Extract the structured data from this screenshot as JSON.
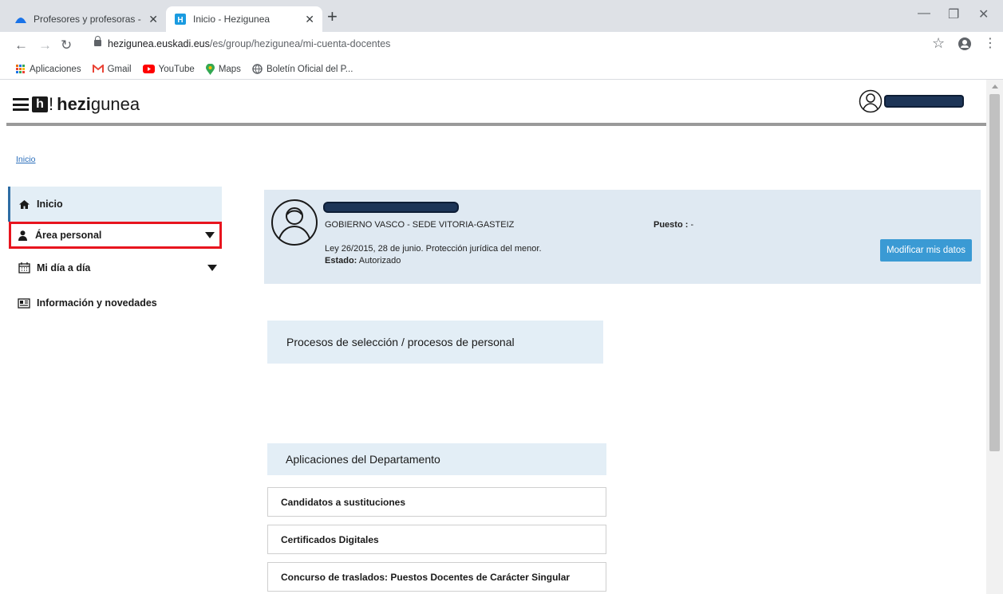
{
  "browser": {
    "tabs": [
      {
        "title": "Profesores y profesoras - Gestión",
        "active": false
      },
      {
        "title": "Inicio - Hezigunea",
        "active": true
      }
    ],
    "url_host": "hezigunea.euskadi.eus",
    "url_path": "/es/group/hezigunea/mi-cuenta-docentes",
    "bookmarks": [
      {
        "label": "Aplicaciones",
        "icon": "apps-grid-icon"
      },
      {
        "label": "Gmail",
        "icon": "gmail-icon"
      },
      {
        "label": "YouTube",
        "icon": "youtube-icon"
      },
      {
        "label": "Maps",
        "icon": "maps-pin-icon"
      },
      {
        "label": "Boletín Oficial del P...",
        "icon": "globe-icon"
      }
    ]
  },
  "site": {
    "logo_bold": "hezi",
    "logo_rest": "gunea",
    "logo_letter": "h",
    "logo_bang": "!"
  },
  "breadcrumb": "Inicio",
  "sidebar": {
    "items": [
      {
        "label": "Inicio",
        "icon": "home-icon",
        "state": "current"
      },
      {
        "label": "Área personal",
        "icon": "person-icon",
        "state": "highlighted",
        "expandable": true
      },
      {
        "label": "Mi día a día",
        "icon": "calendar-icon",
        "expandable": true
      },
      {
        "label": "Información y novedades",
        "icon": "newspaper-icon"
      }
    ]
  },
  "profile": {
    "organization": "GOBIERNO VASCO - SEDE VITORIA-GASTEIZ",
    "law_note": "Ley 26/2015, 28 de junio. Protección jurídica del menor.",
    "estado_label": "Estado:",
    "estado_value": "Autorizado",
    "puesto_label": "Puesto :",
    "puesto_value": "-",
    "modify_button": "Modificar mis datos"
  },
  "sections": {
    "processes_title": "Procesos de selección / procesos de personal",
    "apps_title": "Aplicaciones del Departamento",
    "apps": [
      "Candidatos a sustituciones",
      "Certificados Digitales",
      "Concurso de traslados: Puestos Docentes de Carácter Singular"
    ]
  },
  "colors": {
    "accent": "#3a9ad4",
    "panel": "#dfe9f2",
    "highlight_border": "#e8141e",
    "link": "#2a6ebb"
  }
}
